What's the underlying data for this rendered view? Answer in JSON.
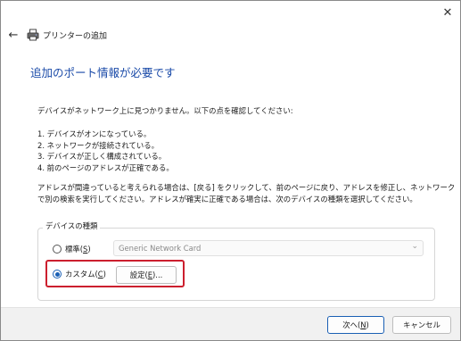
{
  "window": {
    "close_symbol": "✕"
  },
  "header": {
    "back_symbol": "←",
    "title": "プリンターの追加"
  },
  "heading": "追加のポート情報が必要です",
  "intro": "デバイスがネットワーク上に見つかりません。以下の点を確認してください:",
  "checklist": [
    "1. デバイスがオンになっている。",
    "2. ネットワークが接続されている。",
    "3. デバイスが正しく構成されている。",
    "4. 前のページのアドレスが正確である。"
  ],
  "paragraph": [
    "アドレスが間違っていると考えられる場合は、[戻る] をクリックして、前のページに戻り、アドレスを修正し、ネットワーク",
    "で別の検索を実行してください。アドレスが確実に正確である場合は、次のデバイスの種類を選択してください。"
  ],
  "device_group": {
    "label": "デバイスの種類",
    "standard": {
      "label": "標準(",
      "key": "S",
      "suffix": ")",
      "selected": false
    },
    "standard_select": {
      "value": "Generic Network Card",
      "enabled": false
    },
    "custom": {
      "label": "カスタム(",
      "key": "C",
      "suffix": ")",
      "selected": true
    },
    "settings_button": {
      "label": "設定(",
      "key": "E",
      "suffix": ")..."
    }
  },
  "footer": {
    "next_button": {
      "label": "次へ(",
      "key": "N",
      "suffix": ")"
    },
    "cancel_button": {
      "label": "キャンセル"
    }
  },
  "colors": {
    "heading": "#1a4aa8",
    "highlight": "#cc1f2e",
    "accent": "#1a5fb4"
  },
  "icons": {
    "printer": "printer-icon",
    "back": "back-arrow-icon",
    "close": "close-icon",
    "dropdown": "chevron-down-icon"
  }
}
